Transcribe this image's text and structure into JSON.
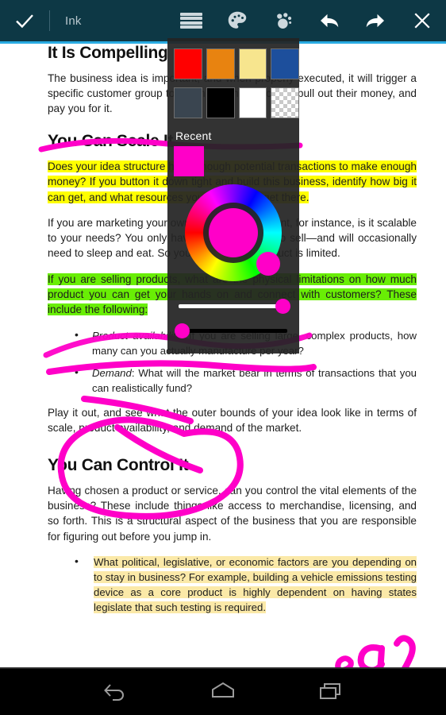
{
  "toolbar": {
    "confirm_label": "check-icon",
    "mode_title": "Ink",
    "icons": [
      {
        "name": "thickness-icon",
        "glyph": "lines"
      },
      {
        "name": "palette-icon",
        "glyph": "palette"
      },
      {
        "name": "brush-icon",
        "glyph": "dots"
      },
      {
        "name": "undo-icon",
        "glyph": "arrow-left"
      },
      {
        "name": "redo-icon",
        "glyph": "arrow-right"
      },
      {
        "name": "close-icon",
        "glyph": "x"
      }
    ],
    "accent_color": "#29abe2",
    "bar_color": "#0d3845"
  },
  "color_picker": {
    "swatches_row1": [
      {
        "name": "red",
        "hex": "#ff0000"
      },
      {
        "name": "orange",
        "hex": "#e88310"
      },
      {
        "name": "pale-yellow",
        "hex": "#f7e58e"
      },
      {
        "name": "blue",
        "hex": "#1d4f9c"
      }
    ],
    "swatches_row2": [
      {
        "name": "slate",
        "hex": "#3a4550"
      },
      {
        "name": "black",
        "hex": "#000000"
      },
      {
        "name": "white",
        "hex": "#ffffff"
      },
      {
        "name": "transparent",
        "hex": "transparent"
      }
    ],
    "recent_label": "Recent",
    "recent_swatches": [
      {
        "name": "magenta",
        "hex": "#ff00c8"
      }
    ],
    "selected_color": "#ff00c8",
    "brightness_value": 100,
    "opacity_value": 8
  },
  "document": {
    "heading1": "It Is Compelling",
    "para1": "The business idea is important, and when properly executed, it will trigger a specific customer group to reach into their pockets, pull out their money, and pay you for it.",
    "heading2": "You Can Scale It",
    "para2_highlighted": "Does your idea structure have enough potential transactions to make enough money? If you button it down tight and build this business, identify how big it can get, and what resources you will need to get there.",
    "para3": "If you are marketing your own time as a consultant, for instance, is it scalable to your needs? You only have 24 hours a day to sell—and will occasionally need to sleep and eat. So your inventory of product is limited.",
    "para4_highlighted": "If you are selling products, what are the physical limitations on how much product you can get your hands on and connect with customers? These include the following:",
    "bullet1_lead": "Product availability",
    "bullet1_text": ": If you are selling large, complex products, how many can you actually manufacture per year?",
    "bullet2_lead": "Demand",
    "bullet2_text": ": What will the market bear in terms of transactions that you can realistically fund?",
    "para5": "Play it out, and see what the outer bounds of your idea look like in terms of scale, product availability, and demand of the market.",
    "heading3": "You Can Control It",
    "para6": "Having chosen a product or service, can you control the vital elements of the business? These include things like access to merchandise, licensing, and so forth. This is a structural aspect of the business that you are responsible for figuring out before you jump in.",
    "bullet3_text": "What political, legislative, or economic factors are you depending on to stay in business? For example, building a vehicle emissions testing device as a core product is highly dependent on having states legislate that such testing is required.",
    "highlight_yellow": "#ffff00",
    "highlight_green": "#69ee05",
    "highlight_cream": "#fbe9a8",
    "ink_color": "#ff00c8"
  },
  "navbar": {
    "back_label": "back-icon",
    "home_label": "home-icon",
    "recents_label": "recents-icon"
  }
}
